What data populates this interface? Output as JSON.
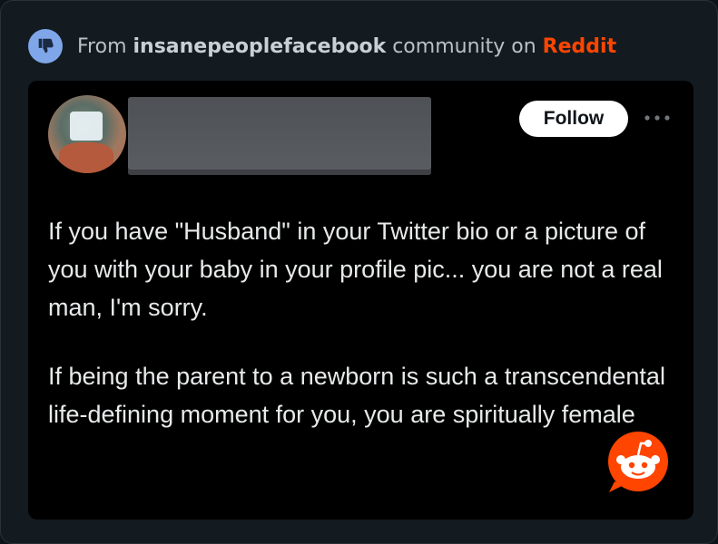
{
  "header": {
    "prefix": "From ",
    "community": "insanepeoplefacebook",
    "middle": " community on ",
    "platform": "Reddit",
    "icon": "thumbs-down-icon"
  },
  "post": {
    "follow_label": "Follow",
    "more_icon": "more-dots-icon",
    "paragraphs": [
      "If you have \"Husband\" in your Twitter bio or a picture of you with your baby in your profile pic... you are not a real man, I'm sorry.",
      "If being the parent to a newborn is such a transcendental life-defining moment for you, you are spiritually female"
    ]
  },
  "watermark": {
    "icon": "reddit-snoo-icon"
  },
  "colors": {
    "background": "#131b20",
    "card": "#000000",
    "reddit_orange": "#ff4500",
    "badge_blue": "#7fa6e8"
  }
}
